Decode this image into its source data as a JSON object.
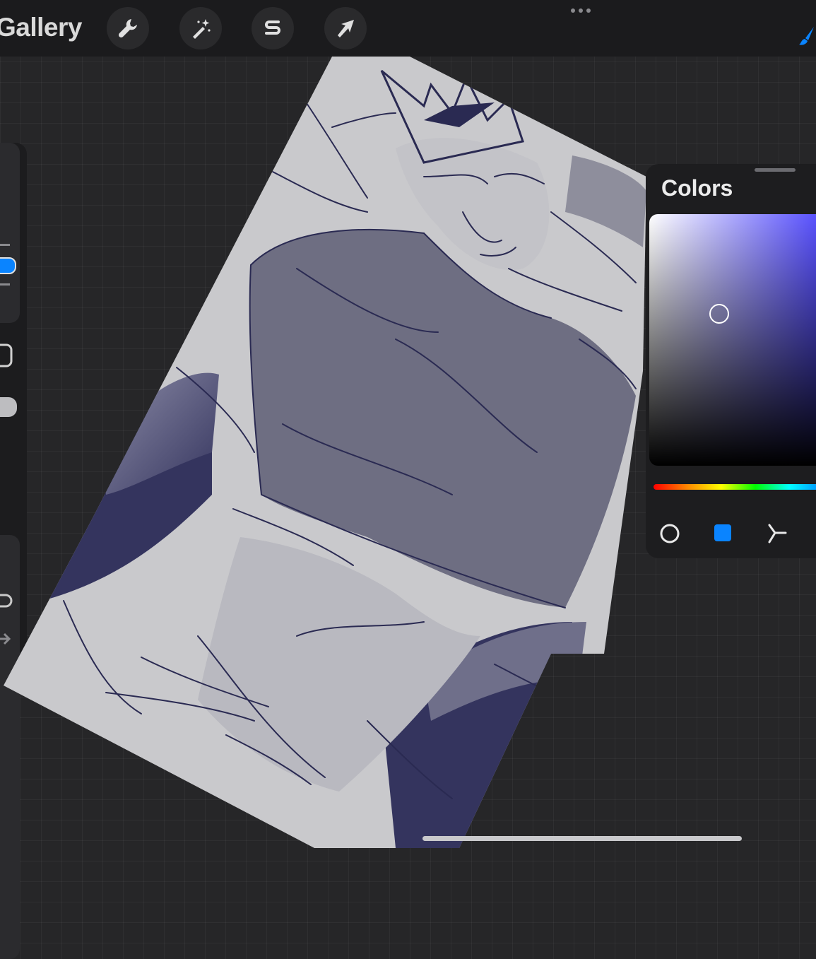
{
  "toolbar": {
    "gallery_label": "Gallery",
    "tools": [
      {
        "name": "actions",
        "icon": "wrench-icon"
      },
      {
        "name": "adjustments",
        "icon": "magic-wand-icon"
      },
      {
        "name": "selection",
        "icon": "selection-s-icon"
      },
      {
        "name": "transform",
        "icon": "arrow-cursor-icon"
      }
    ],
    "more_icon": "ellipsis-icon",
    "brush_icon": "brush-icon",
    "accent_color": "#0a84ff"
  },
  "sidebar": {
    "controls": [
      "brush-size-slider",
      "modify-button",
      "opacity-slider",
      "undo-button",
      "redo-button"
    ]
  },
  "colors_panel": {
    "title": "Colors",
    "picker_hue_color": "#5048ff",
    "current_color": "#6e6e8c",
    "tabs": [
      {
        "name": "disc",
        "icon": "circle-icon"
      },
      {
        "name": "classic",
        "icon": "square-icon",
        "selected": true
      },
      {
        "name": "harmony",
        "icon": "harmony-icon"
      }
    ]
  },
  "canvas": {
    "artwork": "sketch",
    "line_color": "#2a2a52",
    "paper_color": "#c9c9cc",
    "shade_color": "#6b6b7f"
  }
}
